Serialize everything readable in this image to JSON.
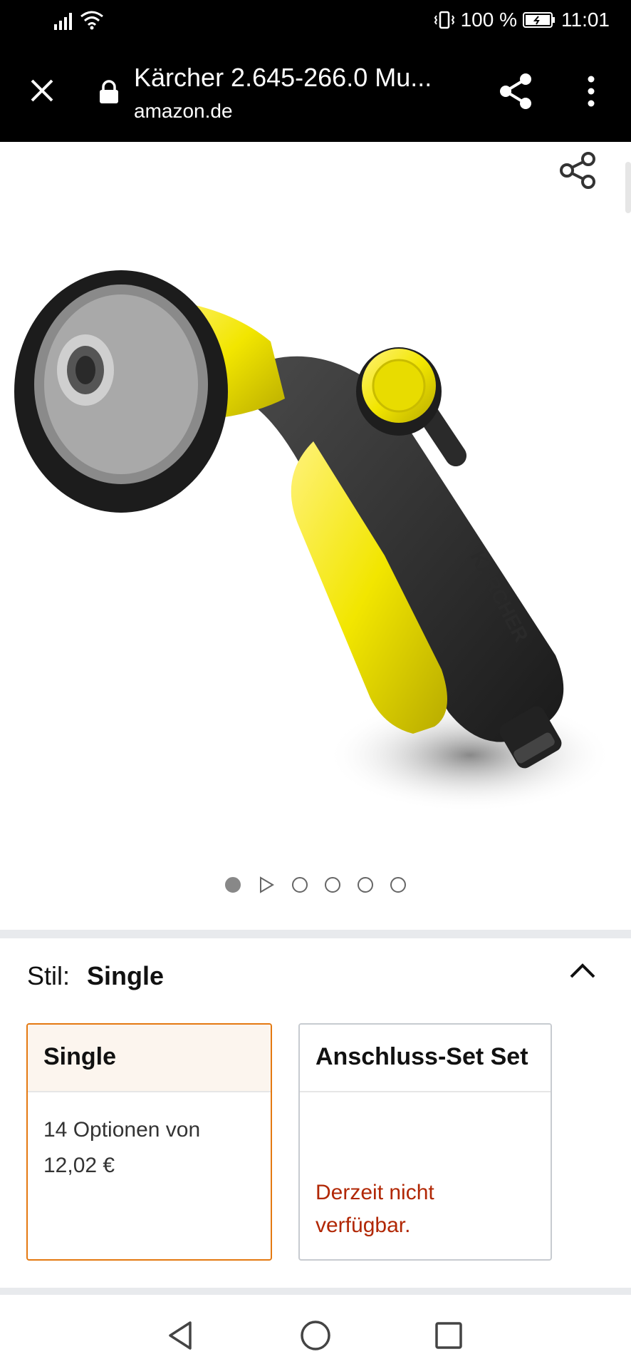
{
  "status": {
    "battery": "100 %",
    "time": "11:01"
  },
  "browser": {
    "title": "Kärcher 2.645-266.0 Mu...",
    "url": "amazon.de"
  },
  "product": {
    "image_icon": "garden-spray-gun-image",
    "image_count": 6,
    "active_index": 0
  },
  "style": {
    "label": "Stil:",
    "value": "Single",
    "options": [
      {
        "title": "Single",
        "line1": "14 Optionen von",
        "line2": "12,02 €",
        "selected": true
      },
      {
        "title": "Anschluss-Set Set",
        "unavailable_line1": "Derzeit nicht",
        "unavailable_line2": "verfügbar.",
        "selected": false
      }
    ]
  },
  "colors": {
    "accent": "#e47911",
    "unavailable": "#b12704",
    "yellow": "#f2e600"
  }
}
